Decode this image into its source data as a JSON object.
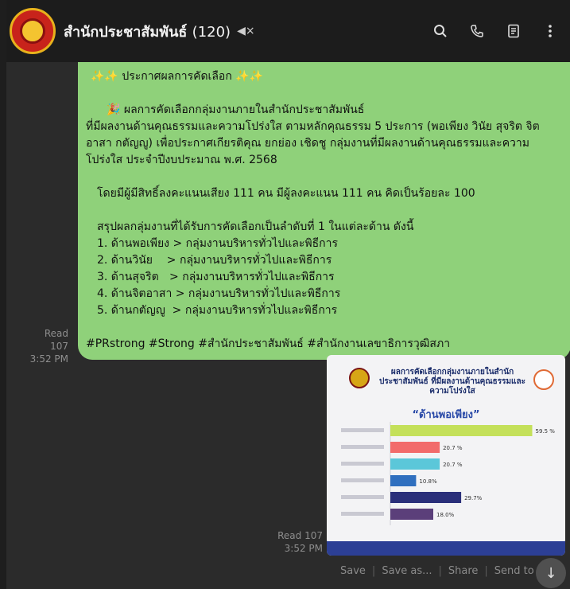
{
  "header": {
    "title": "สำนักประชาสัมพันธ์",
    "member_count": "(120)",
    "mute_icon": "speaker-muted-icon",
    "actions": [
      "search-icon",
      "phone-icon",
      "document-icon",
      "more-vertical-icon"
    ]
  },
  "message": {
    "line1": "✨✨ ประกาศผลการคัดเลือก ✨✨",
    "line2": "🎉 ผลการคัดเลือกกลุ่มงานภายในสำนักประชาสัมพันธ์",
    "line3": "ที่มีผลงานด้านคุณธรรมและความโปร่งใส ตามหลักคุณธรรม 5 ประการ (พอเพียง วินัย สุจริต จิตอาสา กตัญญู) เพื่อประกาศเกียรติคุณ ยกย่อง เชิดชู กลุ่มงานที่มีผลงานด้านคุณธรรมและความโปร่งใส ประจำปีงบประมาณ พ.ศ. 2568",
    "line4": "โดยมีผู้มีสิทธิ์ลงคะแนนเสียง 111 คน มีผู้ลงคะแนน 111 คน คิดเป็นร้อยละ 100",
    "line5": "สรุปผลกลุ่มงานที่ได้รับการคัดเลือกเป็นลำดับที่ 1 ในแต่ละด้าน ดังนี้",
    "items": [
      "1. ด้านพอเพียง > กลุ่มงานบริหารทั่วไปและพิธีการ",
      "2. ด้านวินัย    > กลุ่มงานบริหารทั่วไปและพิธีการ",
      "3. ด้านสุจริต   > กลุ่มงานบริหารทั่วไปและพิธีการ",
      "4. ด้านจิตอาสา > กลุ่มงานบริหารทั่วไปและพิธีการ",
      "5. ด้านกตัญญู  > กลุ่มงานบริหารทั่วไปและพิธีการ"
    ],
    "hashtags": "#PRstrong #Strong #สำนักประชาสัมพันธ์ #สำนักงานเลขาธิการวุฒิสภา",
    "read_label": "Read 107",
    "time": "3:52 PM"
  },
  "image_message": {
    "card_title": "ผลการคัดเลือกกลุ่มงานภายในสำนักประชาสัมพันธ์ ที่มีผลงานด้านคุณธรรมและความโปร่งใส",
    "card_heading": "“ด้านพอเพียง”",
    "read_label": "Read 107",
    "time": "3:52 PM",
    "actions": [
      "Save",
      "Save as...",
      "Share",
      "Send to Keep"
    ]
  },
  "chart_data": {
    "type": "bar",
    "orientation": "horizontal",
    "values": [
      59.5,
      20.7,
      20.7,
      10.8,
      29.7,
      18.0
    ],
    "labels": [
      "59.5 %",
      "20.7 %",
      "20.7 %",
      "10.8%",
      "29.7%",
      "18.0%"
    ],
    "colors": [
      "#c4e05a",
      "#f26b6b",
      "#5bc7d9",
      "#2f6fbf",
      "#2a2f7a",
      "#5b3f7a"
    ]
  },
  "colors": {
    "bubble": "#8fd17a",
    "background": "#2b2b2b",
    "header": "#1c1c1c"
  }
}
